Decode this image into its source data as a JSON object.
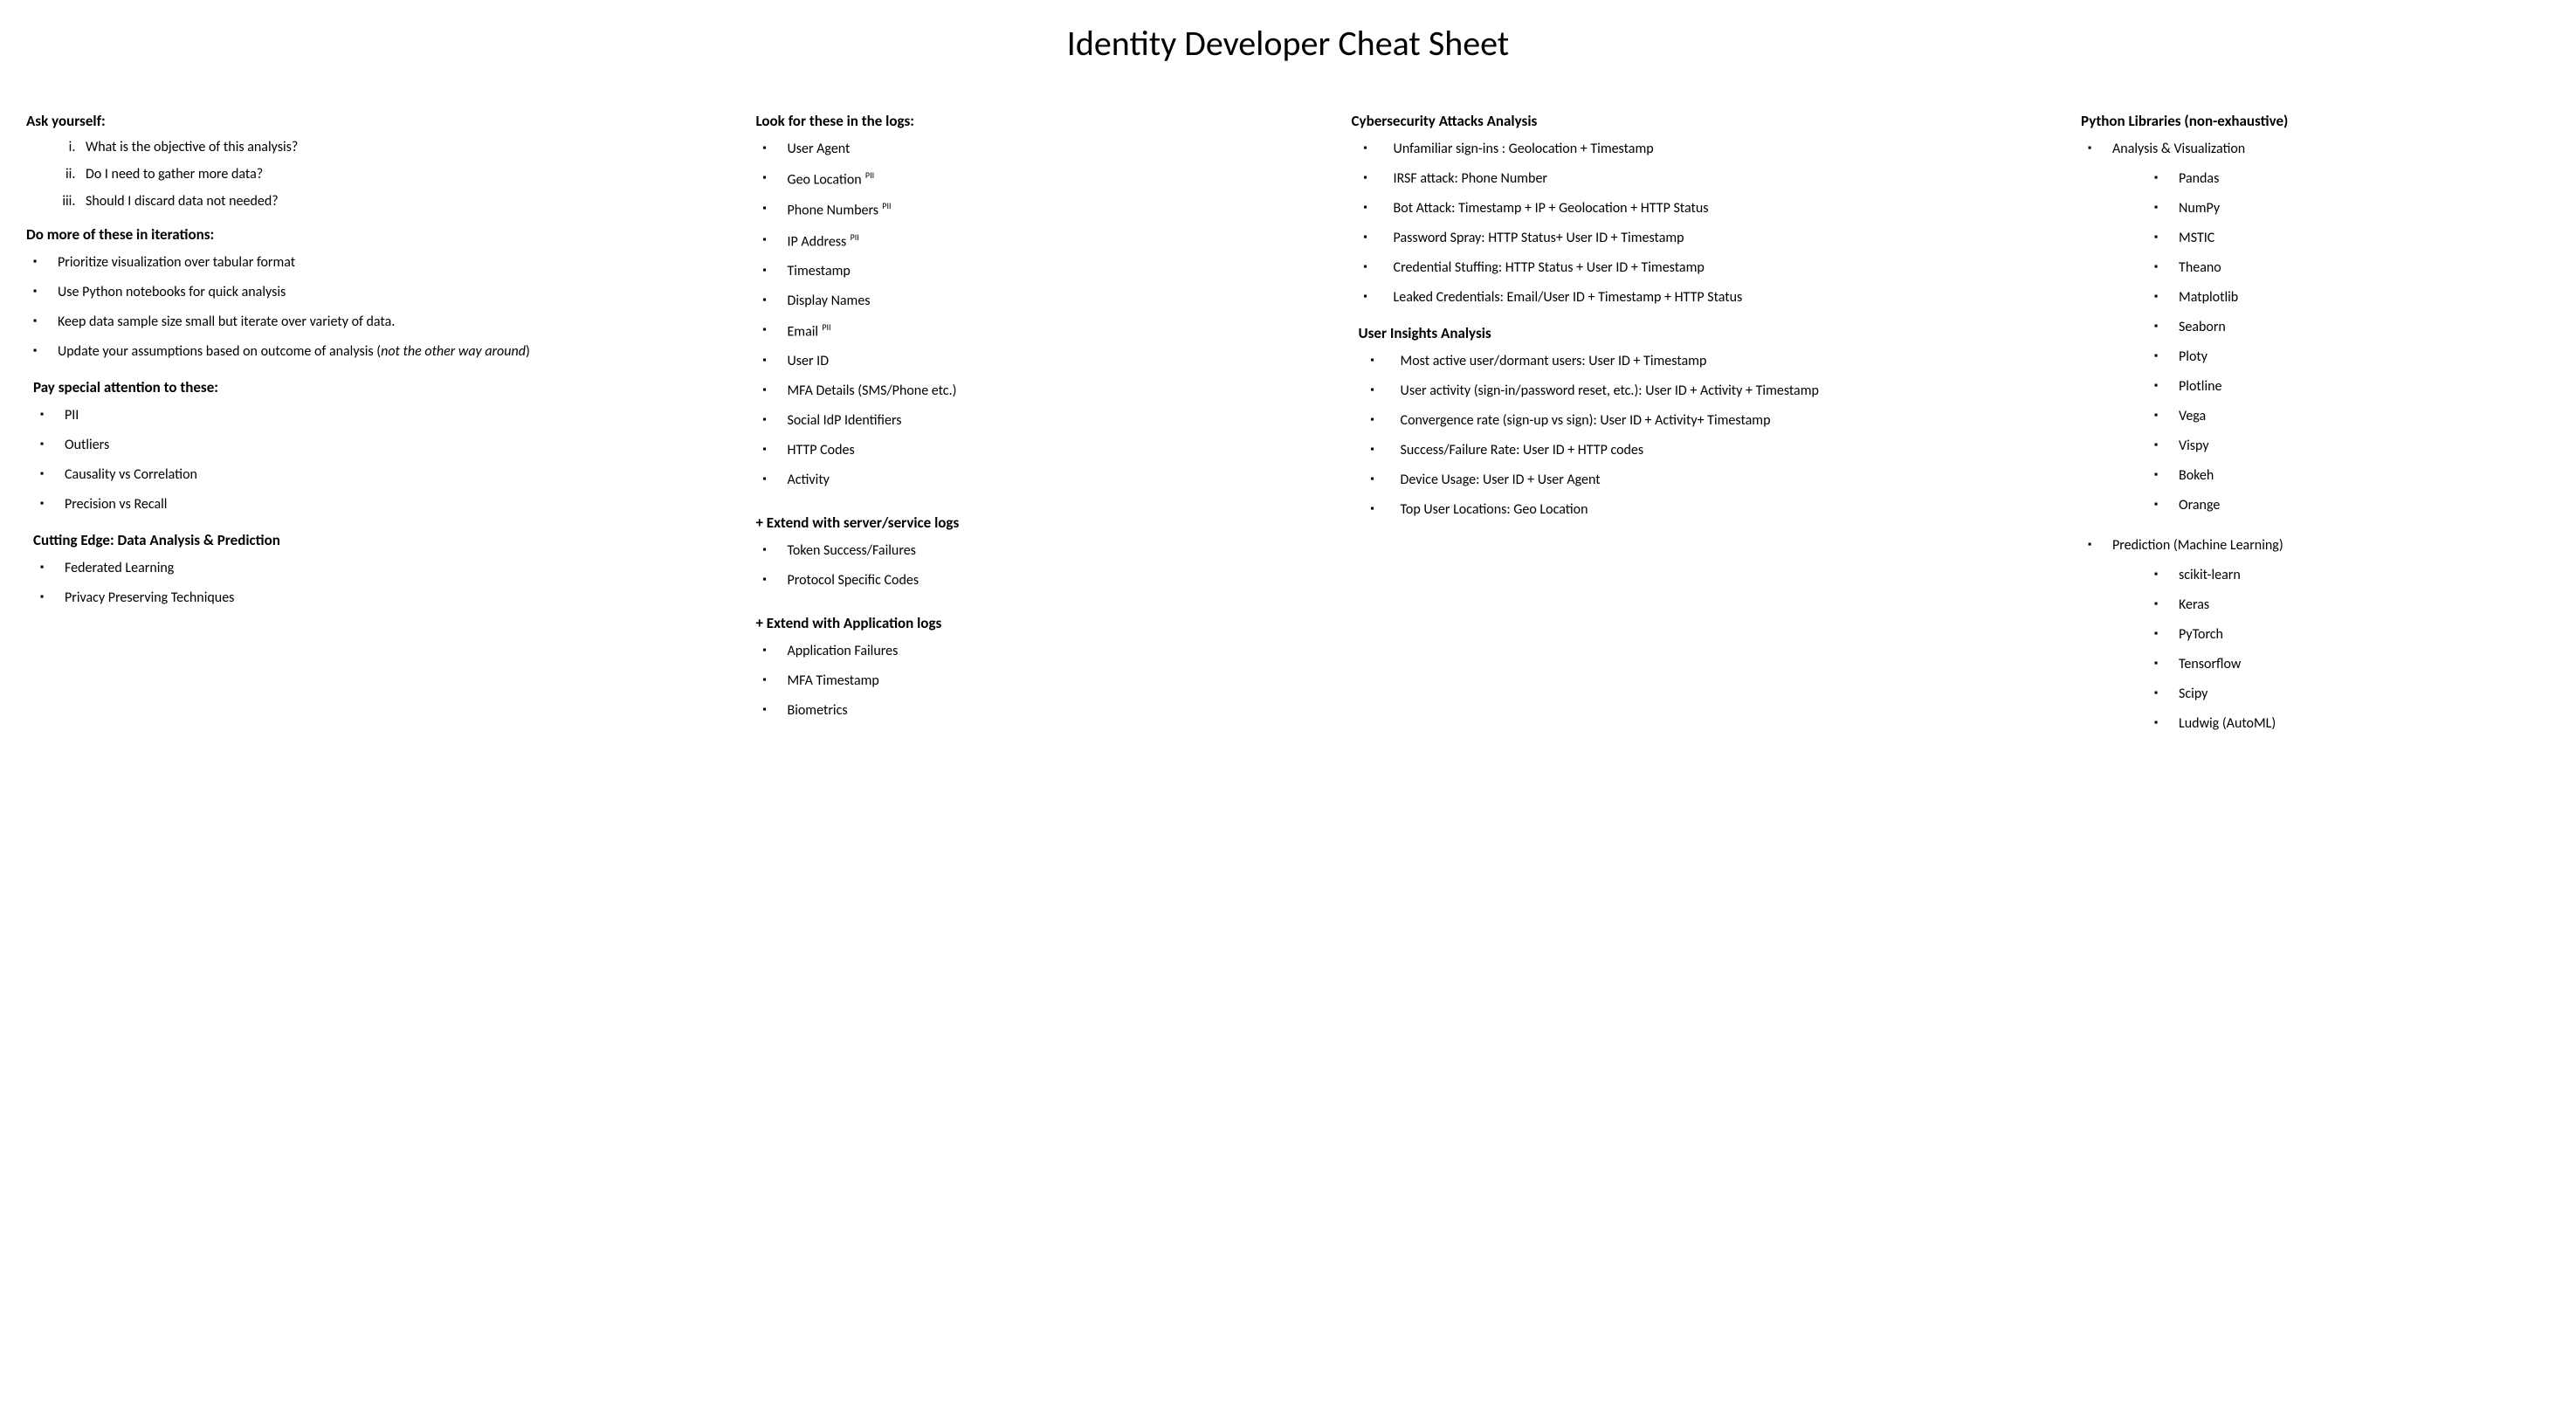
{
  "title": "Identity Developer Cheat Sheet",
  "col1": {
    "h1": "Ask yourself:",
    "q1": "What is the objective of this analysis?",
    "q2": "Do I need to gather more data?",
    "q3": "Should I discard data not needed?",
    "h2": "Do more of these in iterations:",
    "i1": "Prioritize visualization over tabular format",
    "i2": "Use Python notebooks for quick analysis",
    "i3": "Keep data sample size small but iterate over variety of data.",
    "i4a": "Update your assumptions based on outcome of analysis (",
    "i4b": "not the other way around",
    "i4c": ")",
    "h3": "Pay special attention to these:",
    "a1": "PII",
    "a2": "Outliers",
    "a3": "Causality vs Correlation",
    "a4": "Precision vs Recall",
    "h4": "Cutting Edge: Data Analysis & Prediction",
    "c1": "Federated Learning",
    "c2": "Privacy Preserving Techniques"
  },
  "col2": {
    "h1": "Look for these in the logs:",
    "l1": "User Agent",
    "l2a": "Geo Location",
    "l2b": " PII",
    "l3a": "Phone Numbers",
    "l3b": " PII",
    "l4a": "IP Address",
    "l4b": " PII",
    "l5": "Timestamp",
    "l6": "Display Names",
    "l7a": "Email",
    "l7b": " PII",
    "l8": "User ID",
    "l9": "MFA Details (SMS/Phone etc.)",
    "l10": "Social IdP Identifiers",
    "l11": "HTTP Codes",
    "l12": "Activity",
    "h2": "+ Extend with server/service logs",
    "s1": "Token Success/Failures",
    "s2": "Protocol Specific Codes",
    "h3": "+ Extend with Application logs",
    "e1": "Application Failures",
    "e2": "MFA Timestamp",
    "e3": "Biometrics"
  },
  "col3": {
    "h1": "Cybersecurity Attacks Analysis",
    "c1": "Unfamiliar sign-ins :  Geolocation + Timestamp",
    "c2": "IRSF attack: Phone Number",
    "c3": "Bot Attack:  Timestamp + IP + Geolocation + HTTP Status",
    "c4": "Password Spray: HTTP Status+ User ID + Timestamp",
    "c5": "Credential Stuffing: HTTP Status + User ID + Timestamp",
    "c6": "Leaked Credentials: Email/User ID + Timestamp + HTTP Status",
    "h2": "User Insights Analysis",
    "u1": "Most active user/dormant users: User ID + Timestamp",
    "u2": "User activity (sign-in/password reset, etc.): User ID + Activity + Timestamp",
    "u3": "Convergence rate  (sign-up vs sign): User ID + Activity+ Timestamp",
    "u4": "Success/Failure Rate: User ID + HTTP codes",
    "u5": "Device Usage:  User ID + User Agent",
    "u6": "Top User Locations: Geo Location"
  },
  "col4": {
    "h1": "Python Libraries (non-exhaustive)",
    "g1": "Analysis & Visualization",
    "av1": "Pandas",
    "av2": "NumPy",
    "av3": "MSTIC",
    "av4": "Theano",
    "av5": "Matplotlib",
    "av6": "Seaborn",
    "av7": "Ploty",
    "av8": "Plotline",
    "av9": "Vega",
    "av10": "Vispy",
    "av11": "Bokeh",
    "av12": "Orange",
    "g2": "Prediction (Machine Learning)",
    "ml1": "scikit-learn",
    "ml2": "Keras",
    "ml3": "PyTorch",
    "ml4": "Tensorflow",
    "ml5": "Scipy",
    "ml6": "Ludwig (AutoML)"
  }
}
